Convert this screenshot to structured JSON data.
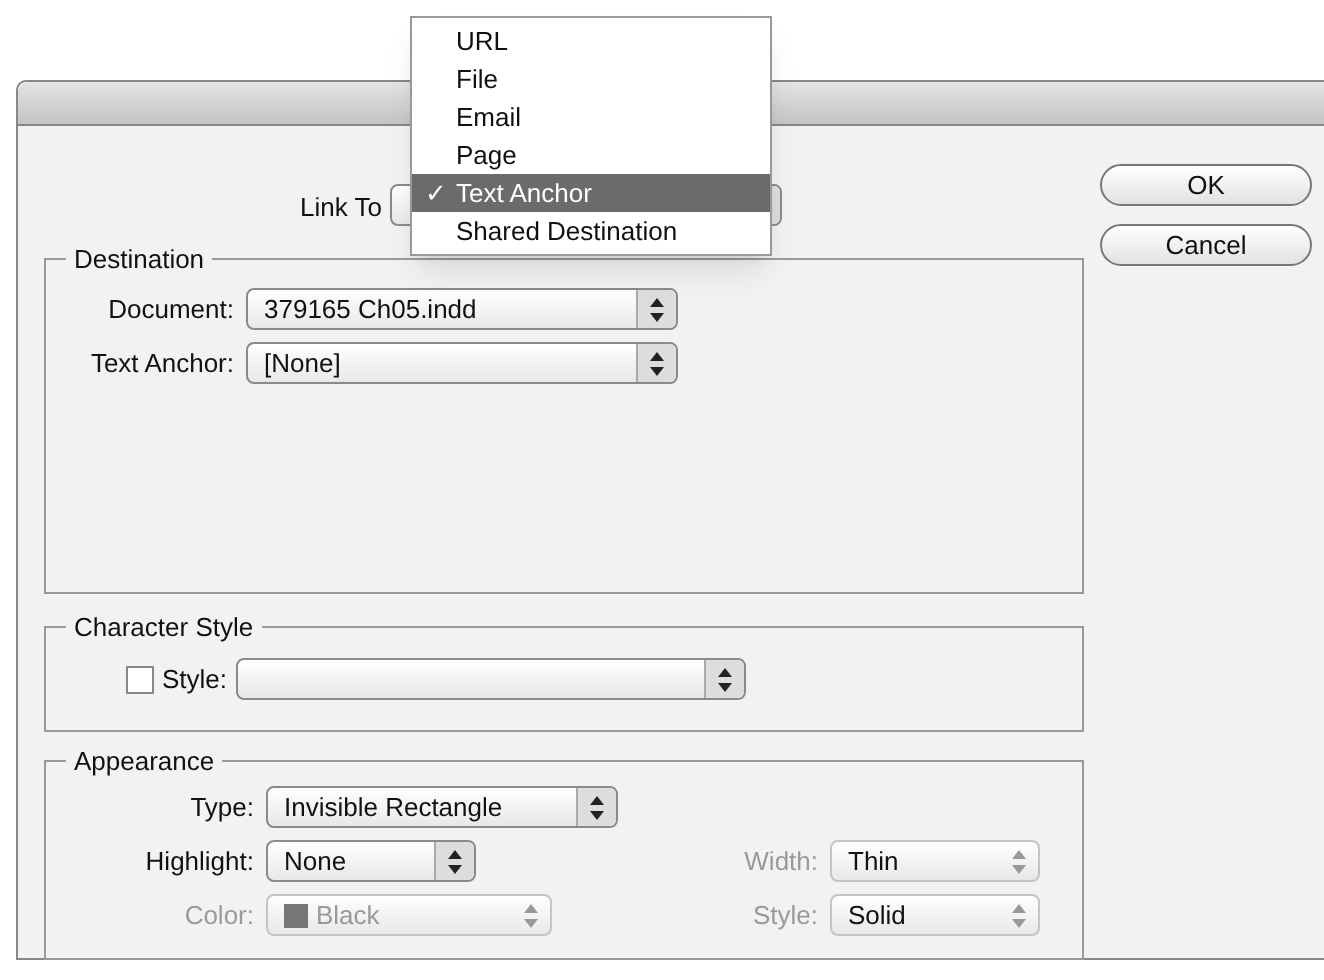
{
  "link_to": {
    "label": "Link To",
    "check": "✓",
    "menu": [
      {
        "label": "URL",
        "selected": false
      },
      {
        "label": "File",
        "selected": false
      },
      {
        "label": "Email",
        "selected": false
      },
      {
        "label": "Page",
        "selected": false
      },
      {
        "label": "Text Anchor",
        "selected": true
      },
      {
        "label": "Shared Destination",
        "selected": false
      }
    ]
  },
  "buttons": [
    "OK",
    "Cancel"
  ],
  "destination": {
    "title": "Destination",
    "fields": [
      {
        "label": "Document:",
        "value": "379165 Ch05.indd"
      },
      {
        "label": "Text Anchor:",
        "value": "[None]"
      }
    ]
  },
  "character_style": {
    "title": "Character Style",
    "checkbox": {
      "label": "Style:",
      "checked": false
    }
  },
  "appearance": {
    "title": "Appearance",
    "type": {
      "label": "Type:",
      "value": "Invisible Rectangle",
      "disabled": false
    },
    "highlight": {
      "label": "Highlight:",
      "value": "None",
      "disabled": false
    },
    "color": {
      "label": "Color:",
      "value": "Black",
      "disabled": true
    },
    "width": {
      "label": "Width:",
      "value": "Thin",
      "disabled": true
    },
    "style": {
      "label": "Style:",
      "value": "Solid",
      "disabled": true
    }
  }
}
